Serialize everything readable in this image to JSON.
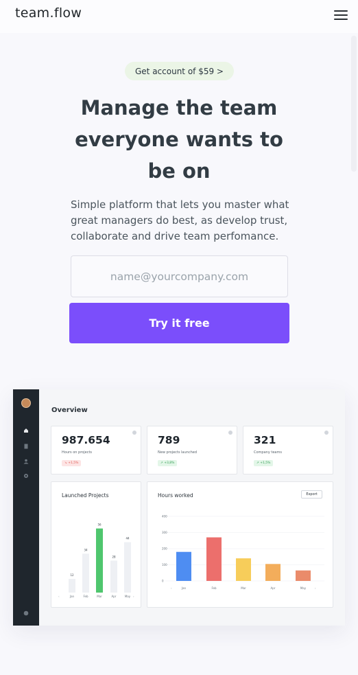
{
  "header": {
    "logo": "team.flow",
    "menu_icon": "hamburger-menu-icon"
  },
  "hero": {
    "badge": "Get account of $59 >",
    "headline": "Manage the team everyone wants to be on",
    "subtitle": "Simple platform that lets you master what great managers do best, as develop trust, collaborate and drive team perfomance.",
    "email_placeholder": "name@yourcompany.com",
    "cta": "Try it free"
  },
  "dashboard": {
    "title": "Overview",
    "sidebar_icons": [
      "home-icon",
      "document-icon",
      "users-icon",
      "gear-icon",
      "help-icon"
    ],
    "stats": [
      {
        "value": "987.654",
        "label": "Hours on projects",
        "change": "↘ +1,5%",
        "trend": "down"
      },
      {
        "value": "789",
        "label": "New projects launched",
        "change": "↗ +3,8%",
        "trend": "up"
      },
      {
        "value": "321",
        "label": "Company teams",
        "change": "↗ +1,5%",
        "trend": "up"
      }
    ],
    "colors": {
      "accent": "#7b4efb",
      "sidebar": "#1f262d",
      "green": "#4fc66e",
      "up_bg": "#e3f6e8",
      "up_fg": "#3aa25a",
      "down_bg": "#fde4e4",
      "down_fg": "#e0605b"
    },
    "export_label": "Export"
  },
  "chart_data": [
    {
      "type": "bar",
      "title": "Launched Projects",
      "categories": [
        "Jan",
        "Feb",
        "Mar",
        "Apr",
        "May"
      ],
      "values": [
        12,
        34,
        56,
        28,
        44
      ],
      "highlight_index": 2,
      "bar_colors": [
        "#eef0f4",
        "#eef0f4",
        "#4fc66e",
        "#eef0f4",
        "#eef0f4"
      ],
      "ylim": [
        0,
        60
      ]
    },
    {
      "type": "bar",
      "title": "Hours worked",
      "categories": [
        "Jan",
        "Feb",
        "Mar",
        "Apr",
        "May"
      ],
      "values": [
        180,
        270,
        140,
        105,
        65
      ],
      "yticks": [
        0,
        100,
        200,
        300,
        400
      ],
      "ylim": [
        0,
        400
      ],
      "bar_colors": [
        "#4e8df2",
        "#ec6f6c",
        "#f7cd5a",
        "#f3ad5b",
        "#ea8b6a"
      ],
      "grid": true
    }
  ]
}
